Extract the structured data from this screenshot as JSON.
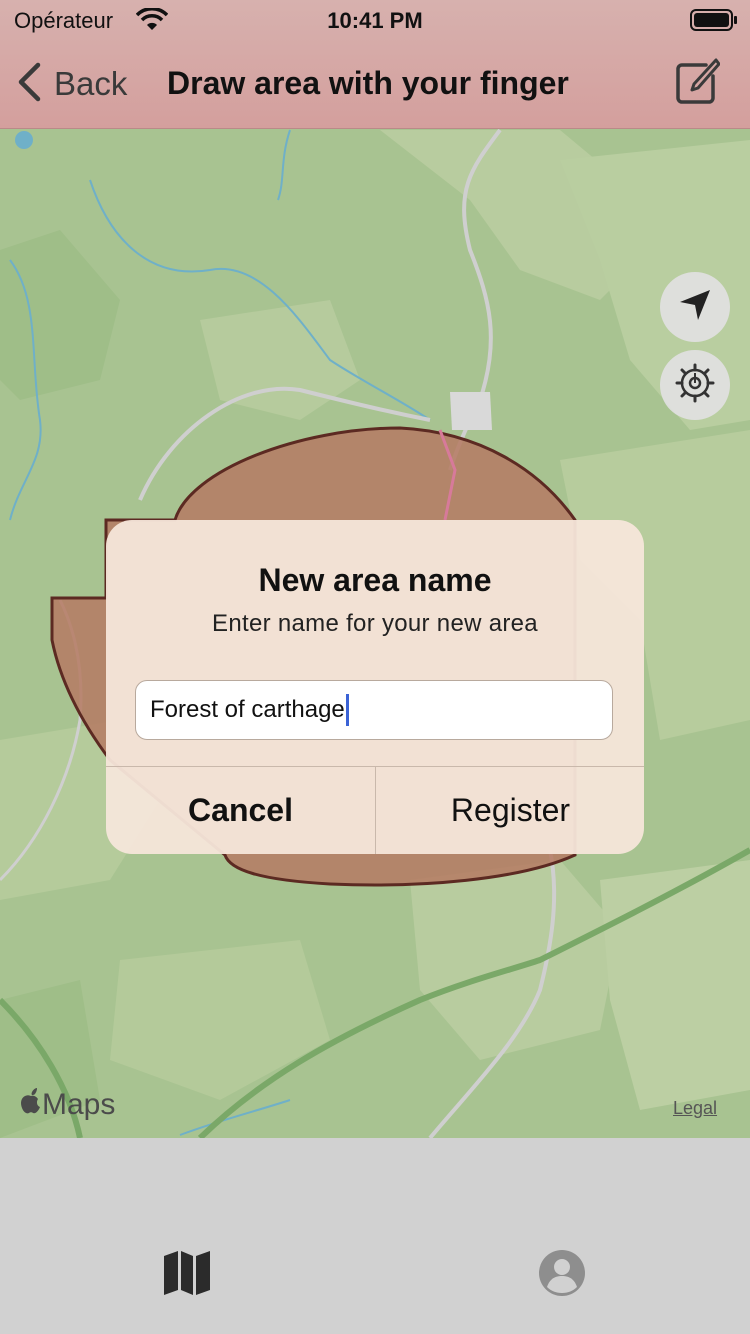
{
  "status_bar": {
    "carrier": "Opérateur",
    "time": "10:41 PM"
  },
  "nav": {
    "back_label": "Back",
    "title": "Draw area with your finger",
    "back_icon": "chevron-left-icon",
    "compose_icon": "compose-icon"
  },
  "map": {
    "attribution": "Maps",
    "legal": "Legal",
    "buttons": [
      {
        "icon": "location-arrow-icon"
      },
      {
        "icon": "gear-icon"
      }
    ]
  },
  "alert": {
    "title": "New area name",
    "message": "Enter name for your new area",
    "input_value": "Forest of carthage",
    "cancel_label": "Cancel",
    "register_label": "Register"
  },
  "tabbar": {
    "tabs": [
      {
        "icon": "map-icon"
      },
      {
        "icon": "profile-icon"
      }
    ]
  },
  "colors": {
    "nav_background": "#d49f9d",
    "area_fill": "#b57a63",
    "area_stroke": "#5c2a22",
    "map_green": "#a8c391",
    "caret": "#3b63d6"
  }
}
